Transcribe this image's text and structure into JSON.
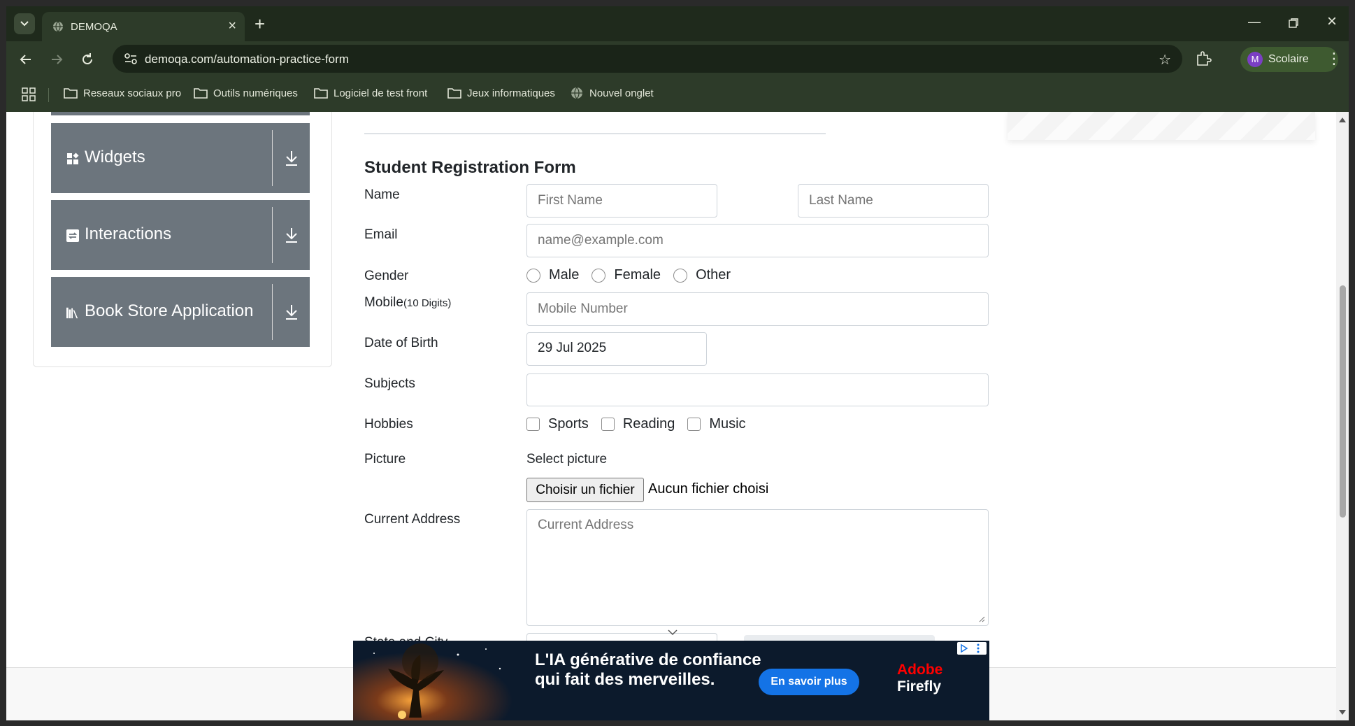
{
  "browser": {
    "tab_title": "DEMOQA",
    "url": "demoqa.com/automation-practice-form",
    "profile_initial": "M",
    "profile_name": "Scolaire",
    "bookmarks": [
      {
        "label": "Reseaux sociaux pro",
        "icon": "folder-icon"
      },
      {
        "label": "Outils numériques",
        "icon": "folder-icon"
      },
      {
        "label": "Logiciel de test front",
        "icon": "folder-icon"
      },
      {
        "label": "Jeux informatiques",
        "icon": "folder-icon"
      },
      {
        "label": "Nouvel onglet",
        "icon": "globe-icon"
      }
    ]
  },
  "sidebar": {
    "groups": [
      {
        "label": "Widgets",
        "icon": "widgets-icon"
      },
      {
        "label": "Interactions",
        "icon": "interactions-icon"
      },
      {
        "label": "Book Store Application",
        "icon": "book-store-icon"
      }
    ]
  },
  "form": {
    "title": "Student Registration Form",
    "name_label": "Name",
    "first_name_placeholder": "First Name",
    "last_name_placeholder": "Last Name",
    "email_label": "Email",
    "email_placeholder": "name@example.com",
    "gender_label": "Gender",
    "gender_options": [
      "Male",
      "Female",
      "Other"
    ],
    "mobile_label": "Mobile",
    "mobile_hint": "(10 Digits)",
    "mobile_placeholder": "Mobile Number",
    "dob_label": "Date of Birth",
    "dob_value": "29 Jul 2025",
    "subjects_label": "Subjects",
    "subjects_value": "",
    "hobbies_label": "Hobbies",
    "hobbies_options": [
      "Sports",
      "Reading",
      "Music"
    ],
    "picture_label": "Picture",
    "picture_hint": "Select picture",
    "file_button": "Choisir un fichier",
    "file_status": "Aucun fichier choisi",
    "address_label": "Current Address",
    "address_placeholder": "Current Address",
    "state_city_label": "State and City"
  },
  "ad": {
    "headline": "L'IA générative de confiance qui fait des merveilles.",
    "cta": "En savoir plus",
    "brand_line1": "Adobe",
    "brand_line2": "Firefly"
  },
  "colors": {
    "chrome_bg": "#2d3b29",
    "sidebar_group": "#6c757d",
    "ad_cta": "#1473e6",
    "adobe_red": "#ff0000"
  }
}
